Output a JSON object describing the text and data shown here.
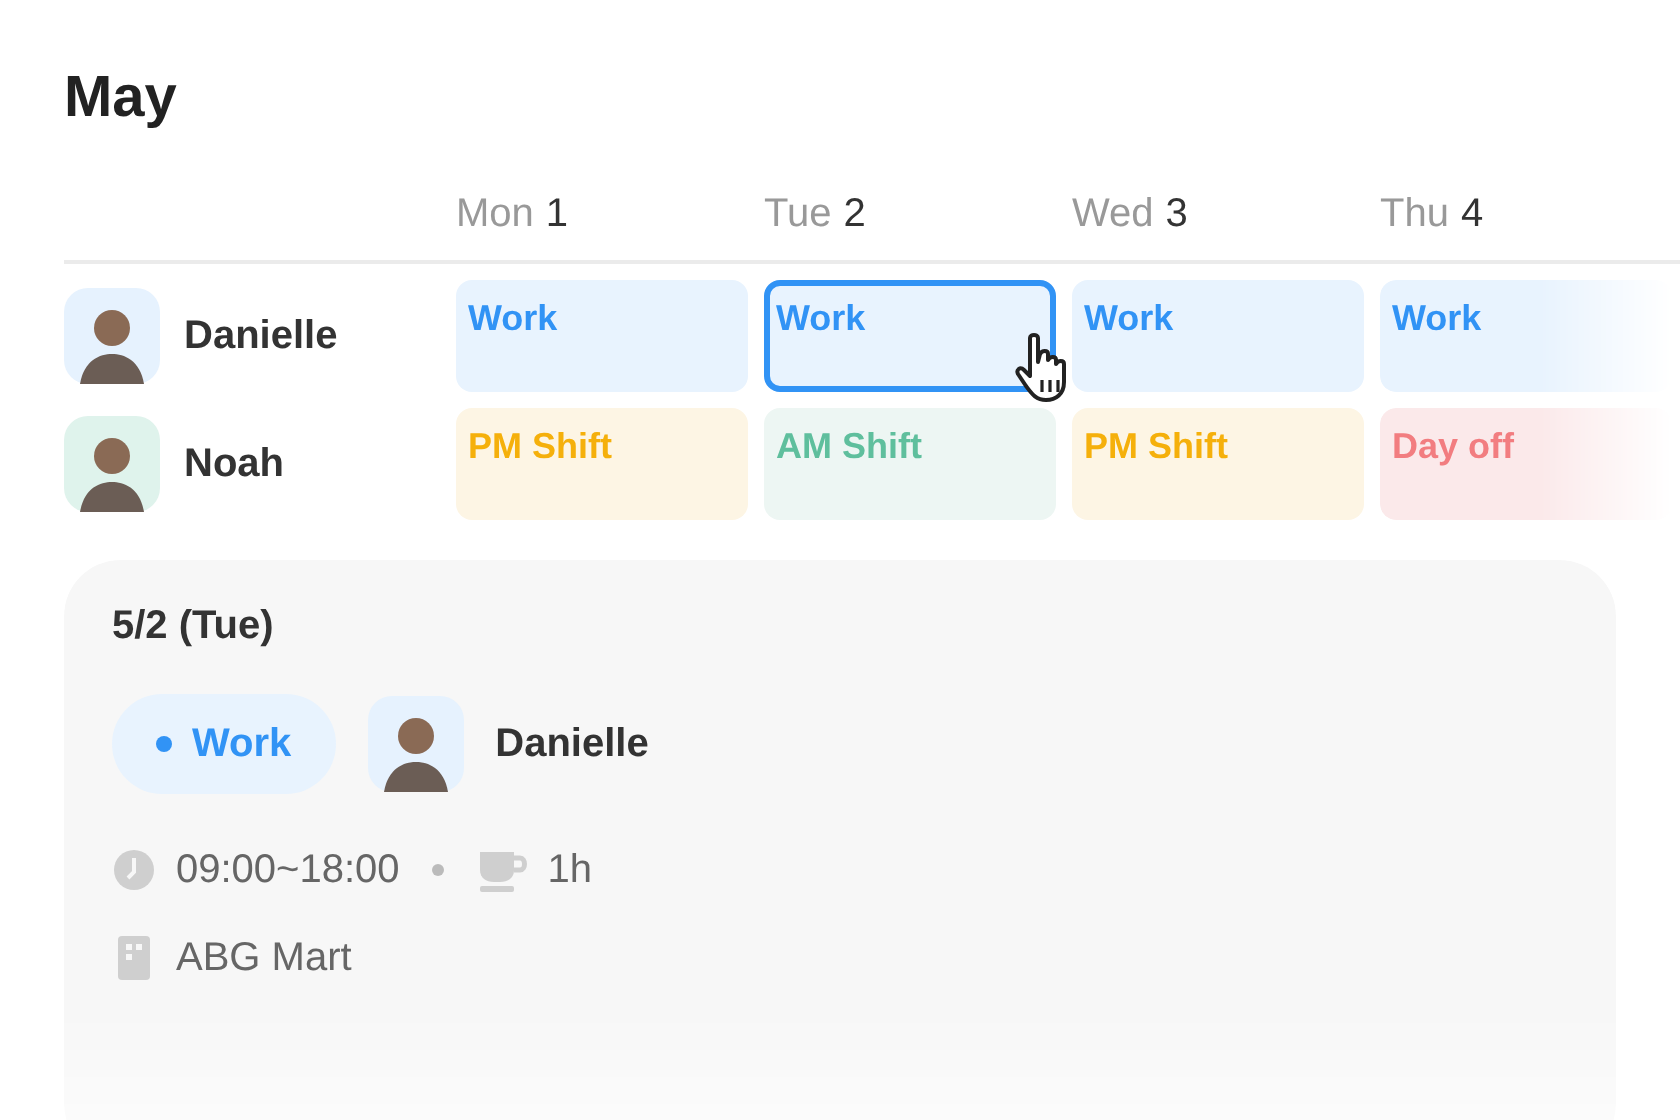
{
  "title": "May",
  "days": [
    {
      "weekday": "Mon",
      "date": "1"
    },
    {
      "weekday": "Tue",
      "date": "2"
    },
    {
      "weekday": "Wed",
      "date": "3"
    },
    {
      "weekday": "Thu",
      "date": "4"
    }
  ],
  "people": [
    {
      "name": "Danielle",
      "color": "#e6f2fe",
      "shifts": [
        {
          "kind": "work",
          "label": "Work",
          "selected": false
        },
        {
          "kind": "work",
          "label": "Work",
          "selected": true
        },
        {
          "kind": "work",
          "label": "Work",
          "selected": false
        },
        {
          "kind": "work",
          "label": "Work",
          "selected": false
        }
      ]
    },
    {
      "name": "Noah",
      "color": "#dff3ec",
      "shifts": [
        {
          "kind": "pm",
          "label": "PM Shift",
          "selected": false
        },
        {
          "kind": "am",
          "label": "AM Shift",
          "selected": false
        },
        {
          "kind": "pm",
          "label": "PM Shift",
          "selected": false
        },
        {
          "kind": "off",
          "label": "Day off",
          "selected": false
        }
      ]
    }
  ],
  "detail": {
    "date": "5/2 (Tue)",
    "shift": {
      "kind": "work",
      "label": "Work"
    },
    "person": {
      "name": "Danielle",
      "color": "#e6f2fe"
    },
    "time": "09:00~18:00",
    "break": "1h",
    "place": "ABG Mart"
  }
}
